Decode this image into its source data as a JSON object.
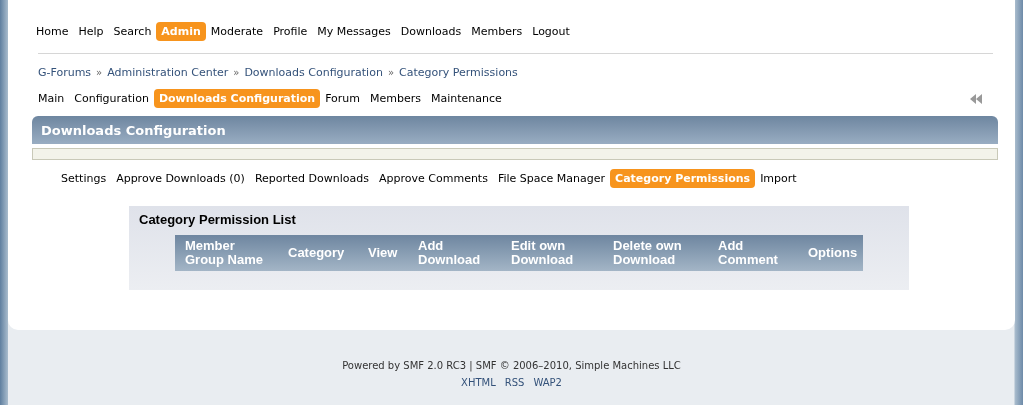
{
  "main_menu": [
    {
      "label": "Home",
      "selected": false
    },
    {
      "label": "Help",
      "selected": false
    },
    {
      "label": "Search",
      "selected": false
    },
    {
      "label": "Admin",
      "selected": true
    },
    {
      "label": "Moderate",
      "selected": false
    },
    {
      "label": "Profile",
      "selected": false
    },
    {
      "label": "My Messages",
      "selected": false
    },
    {
      "label": "Downloads",
      "selected": false
    },
    {
      "label": "Members",
      "selected": false
    },
    {
      "label": "Logout",
      "selected": false
    }
  ],
  "breadcrumb": [
    "G-Forums",
    "Administration Center",
    "Downloads Configuration",
    "Category Permissions"
  ],
  "breadcrumb_separator": "»",
  "admin_menu": [
    {
      "label": "Main",
      "selected": false
    },
    {
      "label": "Configuration",
      "selected": false
    },
    {
      "label": "Downloads Configuration",
      "selected": true
    },
    {
      "label": "Forum",
      "selected": false
    },
    {
      "label": "Members",
      "selected": false
    },
    {
      "label": "Maintenance",
      "selected": false
    }
  ],
  "section_title": "Downloads Configuration",
  "sub_menu": [
    {
      "label": "Settings",
      "selected": false
    },
    {
      "label": "Approve Downloads (0)",
      "selected": false
    },
    {
      "label": "Reported Downloads",
      "selected": false
    },
    {
      "label": "Approve Comments",
      "selected": false
    },
    {
      "label": "File Space Manager",
      "selected": false
    },
    {
      "label": "Category Permissions",
      "selected": true
    },
    {
      "label": "Import",
      "selected": false
    }
  ],
  "permission_list": {
    "title": "Category Permission List",
    "columns": [
      "Member Group Name",
      "Category",
      "View",
      "Add Download",
      "Edit own Download",
      "Delete own Download",
      "Add Comment",
      "Options"
    ]
  },
  "footer": {
    "credit": "Powered by SMF 2.0 RC3 | SMF © 2006–2010, Simple Machines LLC",
    "links": [
      "XHTML",
      "RSS",
      "WAP2"
    ]
  }
}
